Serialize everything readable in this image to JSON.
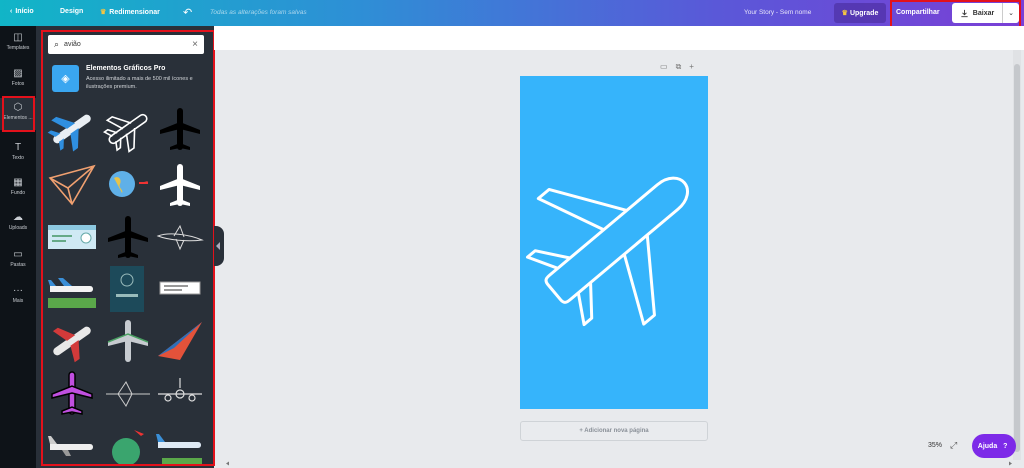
{
  "topbar": {
    "back_label": "Início",
    "design_label": "Design",
    "resize_label": "Redimensionar",
    "saved_text": "Todas as alterações foram salvas",
    "doc_title": "Your Story - Sem nome",
    "upgrade_label": "Upgrade",
    "share_label": "Compartilhar",
    "download_label": "Baixar"
  },
  "rail": {
    "items": [
      {
        "label": "Templates",
        "icon": "layout-icon"
      },
      {
        "label": "Fotos",
        "icon": "photo-icon"
      },
      {
        "label": "Elementos ...",
        "icon": "shapes-icon"
      },
      {
        "label": "Texto",
        "icon": "text-icon"
      },
      {
        "label": "Fundo",
        "icon": "pattern-icon"
      },
      {
        "label": "Uploads",
        "icon": "cloud-upload-icon"
      },
      {
        "label": "Pastas",
        "icon": "folder-icon"
      },
      {
        "label": "Mais",
        "icon": "more-icon"
      }
    ]
  },
  "panel": {
    "search_value": "avião",
    "pro_title": "Elementos Gráficos Pro",
    "pro_desc": "Acesso ilimitado a mais de 500 mil ícones e ilustrações premium."
  },
  "canvas": {
    "add_page_label": "+ Adicionar nova página",
    "page_color": "#36b4fb",
    "zoom_label": "35%",
    "help_label": "Ajuda",
    "help_q": "?"
  },
  "colors": {
    "accent_purple": "#7d2ae8",
    "highlight_red": "#e3111b",
    "rail_bg": "#0e1318",
    "panel_bg": "#293039"
  }
}
